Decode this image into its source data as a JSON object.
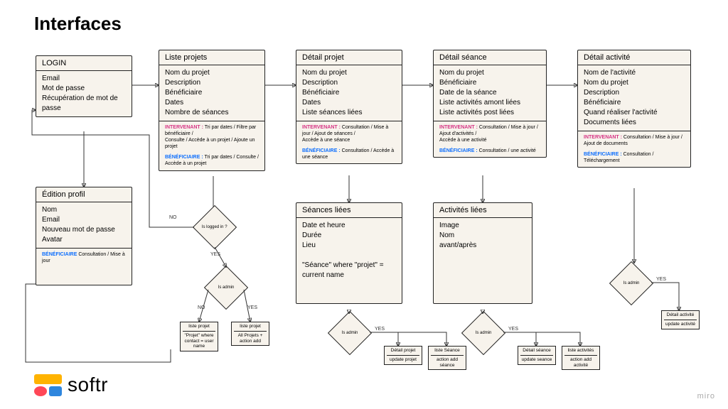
{
  "page_title": "Interfaces",
  "cards": {
    "login": {
      "header": "LOGIN",
      "body": "Email\nMot de passe\nRécupération de mot de passe"
    },
    "profil": {
      "header": "Édition profil",
      "body": "Nom\nEmail\nNouveau mot de passe\nAvatar",
      "ben_note": "Consultation / Mise à jour"
    },
    "liste_projets": {
      "header": "Liste projets",
      "body": "Nom du projet\nDescription\nBénéficiaire\nDates\nNombre de séances",
      "int_note": "Tri par dates / Filtre par bénéficiaire /\nConsulte / Accède à un projet / Ajoute un projet",
      "ben_note": "Tri par dates / Consulte /\nAccède à un projet"
    },
    "detail_projet": {
      "header": "Détail projet",
      "body": "Nom du projet\nDescription\nBénéficiaire\nDates\nListe séances liées",
      "int_note": "Consultation / Mise à jour / Ajout de séances /\nAccède à une séance",
      "ben_note": "Consultation / Accède à une séance"
    },
    "detail_seance": {
      "header": "Détail séance",
      "body": "Nom du projet\nBénéficiaire\nDate de la séance\nListe activités amont liées\nListe activités post liées",
      "int_note": "Consultation / Mise à jour / Ajout d'activités /\nAccède à une activité",
      "ben_note": "Consultation / une activité"
    },
    "detail_activite": {
      "header": "Détail activité",
      "body": "Nom de l'activité\nNom du projet\nDescription\nBénéficiaire\nQuand réaliser l'activité\nDocuments liées",
      "int_note": "Consultation / Mise à jour / Ajout de documents",
      "ben_note": "Consultation / Téléchargement"
    },
    "seances_liees": {
      "header": "Séances liées",
      "body": "Date et heure\nDurée\nLieu\n\n\"Séance\" where \"projet\" = current name"
    },
    "activites_liees": {
      "header": "Activités liées",
      "body": "Image\nNom\navant/après"
    }
  },
  "role_labels": {
    "intervenant": "INTERVENANT :",
    "beneficiaire": "BÉNÉFICIAIRE :",
    "beneficiaire_short": "BÉNÉFICIAIRE"
  },
  "decisions": {
    "is_logged": "Is logged in ?",
    "is_admin": "Is admin"
  },
  "edge_labels": {
    "yes": "YES",
    "no": "NO"
  },
  "smallboxes": {
    "liste_projet_user": {
      "title": "liste projet",
      "body": "\"Projet\" where contact = user name"
    },
    "liste_projet_all": {
      "title": "liste projet",
      "body": "All Projets + action add"
    },
    "detail_projet": {
      "title": "Détail projet",
      "body": "update projet"
    },
    "liste_seance": {
      "title": "liste Séance",
      "body": "action add séance"
    },
    "detail_seance": {
      "title": "Détail séance",
      "body": "update seance"
    },
    "liste_activites": {
      "title": "liste activités",
      "body": "action add activité"
    },
    "detail_activite": {
      "title": "Détail activité",
      "body": "update activité"
    }
  },
  "logo_text": "softr",
  "watermark": "miro"
}
